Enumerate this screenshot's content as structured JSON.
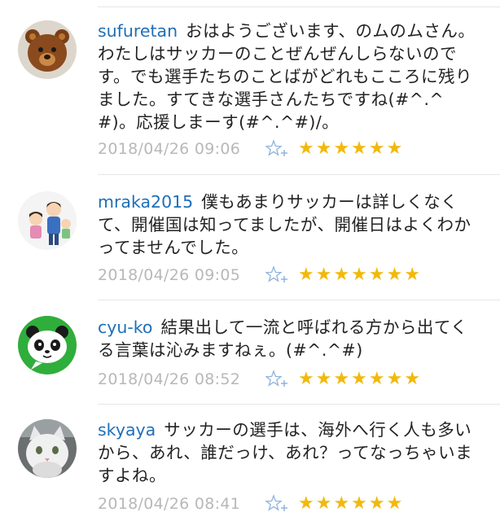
{
  "comments": [
    {
      "username": "sufuretan",
      "text": "おはようございます、のムのムさん。わたしはサッカーのことぜんぜんしらないのです。でも選手たちのことばがどれもこころに残りました。すてきな選手さんたちですね(#^.^#)。応援しまーす(#^.^#)/。",
      "timestamp": "2018/04/26 09:06",
      "stars": "★★★★★★",
      "avatar": "teddy-bear-avatar"
    },
    {
      "username": "mraka2015",
      "text": "僕もあまりサッカーは詳しくなくて、開催国は知ってましたが、開催日はよくわかってませんでした。",
      "timestamp": "2018/04/26 09:05",
      "stars": "★★★★★★★",
      "avatar": "family-illustration-avatar"
    },
    {
      "username": "cyu-ko",
      "text": "結果出して一流と呼ばれる方から出てくる言葉は沁みますねぇ。(#^.^#)",
      "timestamp": "2018/04/26 08:52",
      "stars": "★★★★★★★",
      "avatar": "panda-avatar"
    },
    {
      "username": "skyaya",
      "text": "サッカーの選手は、海外へ行く人も多いから、あれ、誰だっけ、あれ？ってなっちゃいますよね。",
      "timestamp": "2018/04/26 08:41",
      "stars": "★★★★★★",
      "avatar": "cat-photo-avatar"
    }
  ],
  "icons": {
    "add_star": "add-star-icon",
    "star_color": "#f2b90c",
    "username_color": "#1e6fb8",
    "timestamp_color": "#b8b8b8"
  }
}
